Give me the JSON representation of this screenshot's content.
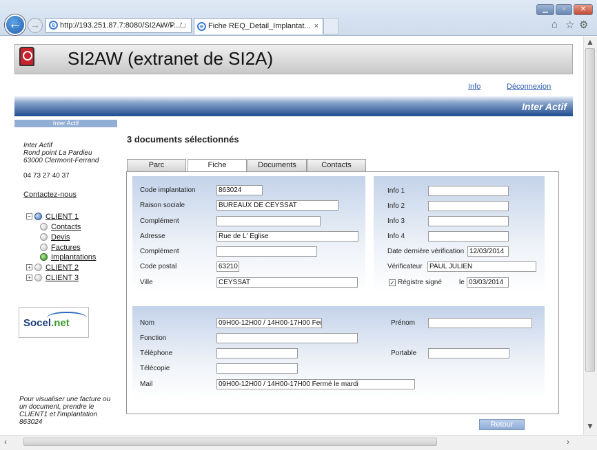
{
  "browser": {
    "address": "http://193.251.87.7:8080/SI2AW/P...",
    "tab_title": "Fiche REQ_Detail_Implantat...",
    "addr_tools": "⌕ ▾ ↻",
    "back_icon": "←",
    "forward_icon": "→",
    "home_icon": "⌂",
    "favorites_icon": "☆",
    "tools_icon": "⚙",
    "min_icon": "▁",
    "max_icon": "▫",
    "close_icon": "✕"
  },
  "header": {
    "title": "SI2AW (extranet de SI2A)",
    "links": {
      "info": "Info",
      "logout": "Déconnexion"
    },
    "company": "Inter Actif"
  },
  "sidebar": {
    "heading": "Inter Actif",
    "address_lines": [
      "Inter Actif",
      "Rond point La Pardieu",
      "63000 Clermont-Ferrand"
    ],
    "phone": "04 73 27 40 37",
    "contact": "Contactez-nous",
    "tree": {
      "client1": "CLIENT 1",
      "children": [
        "Contacts",
        "Devis",
        "Factures",
        "Implantations"
      ],
      "client2": "CLIENT 2",
      "client3": "CLIENT 3"
    },
    "logo_text": "Socel",
    "logo_text_suffix": ".net",
    "footnote": "Pour visualiser une facture ou un document, prendre le CLIENT1 et l'implantation 863024"
  },
  "main": {
    "title": "3 documents sélectionnés",
    "tabs": [
      "Parc",
      "Fiche",
      "Documents",
      "Contacts"
    ],
    "active_tab": "Fiche",
    "fields_left": {
      "code_implantation": {
        "label": "Code implantation",
        "value": "863024"
      },
      "raison_sociale": {
        "label": "Raison sociale",
        "value": "BUREAUX DE CEYSSAT"
      },
      "complement1": {
        "label": "Complément",
        "value": ""
      },
      "adresse": {
        "label": "Adresse",
        "value": "Rue de L' Eglise"
      },
      "complement2": {
        "label": "Complément",
        "value": ""
      },
      "code_postal": {
        "label": "Code postal",
        "value": "63210"
      },
      "ville": {
        "label": "Ville",
        "value": "CEYSSAT"
      }
    },
    "fields_right": {
      "info1": {
        "label": "Info 1",
        "value": ""
      },
      "info2": {
        "label": "Info 2",
        "value": ""
      },
      "info3": {
        "label": "Info 3",
        "value": ""
      },
      "info4": {
        "label": "Info 4",
        "value": ""
      },
      "derniere_verif": {
        "label": "Date dernière vérification",
        "value": "12/03/2014"
      },
      "verificateur": {
        "label": "Vérificateur",
        "value": "PAUL JULIEN"
      },
      "registre": {
        "label": "Régistre signé",
        "checked": true,
        "le_label": "le",
        "date": "03/03/2014"
      }
    },
    "contact_fields": {
      "nom": {
        "label": "Nom",
        "value": "09H00-12H00 / 14H00-17H00 Fer"
      },
      "prenom": {
        "label": "Prénom",
        "value": ""
      },
      "fonction": {
        "label": "Fonction",
        "value": ""
      },
      "telephone": {
        "label": "Téléphone",
        "value": ""
      },
      "portable": {
        "label": "Portable",
        "value": ""
      },
      "telecopie": {
        "label": "Télécopie",
        "value": ""
      },
      "mail": {
        "label": "Mail",
        "value": "09H00-12H00 / 14H00-17H00 Fermé le mardi"
      }
    },
    "retour": "Retour"
  }
}
